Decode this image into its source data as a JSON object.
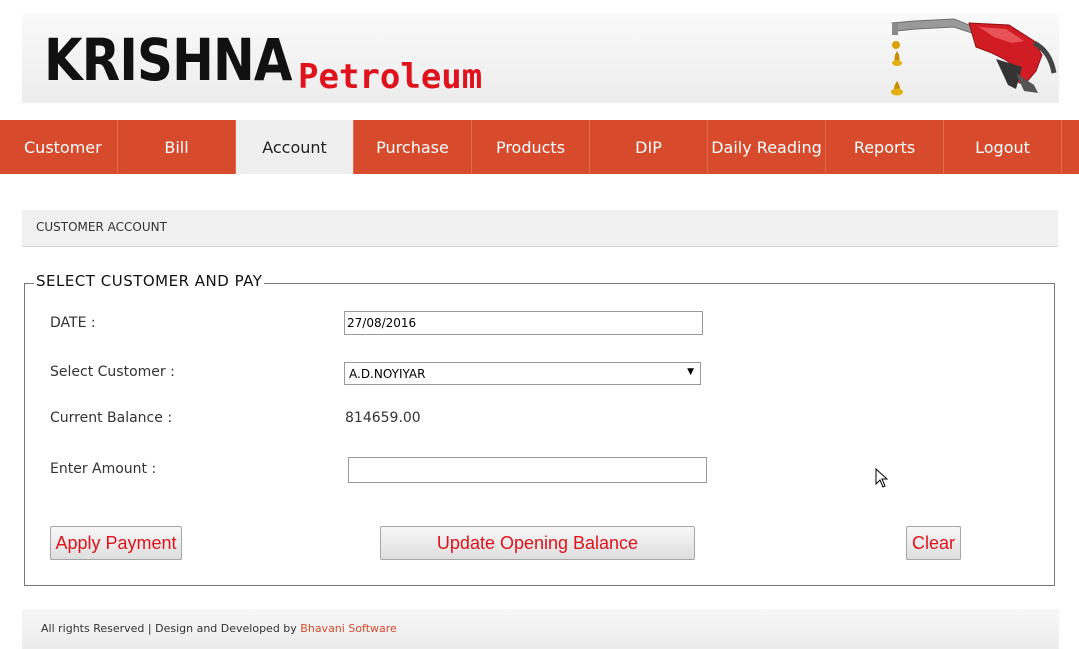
{
  "header": {
    "brand_main": "KRISHNA",
    "brand_sub": "Petroleum",
    "logo_icon": "fuel-nozzle-icon"
  },
  "nav": {
    "items": [
      {
        "label": "Customer"
      },
      {
        "label": "Bill"
      },
      {
        "label": "Account",
        "active": true
      },
      {
        "label": "Purchase"
      },
      {
        "label": "Products"
      },
      {
        "label": "DIP"
      },
      {
        "label": "Daily Reading"
      },
      {
        "label": "Reports"
      },
      {
        "label": "Logout"
      }
    ],
    "color": "#d84a2c"
  },
  "section": {
    "title": "CUSTOMER ACCOUNT"
  },
  "form": {
    "legend": "SELECT  CUSTOMER  AND PAY",
    "date_label": "DATE :",
    "date_value": "27/08/2016",
    "customer_label": "Select Customer :",
    "customer_value": "A.D.NOYIYAR",
    "balance_label": "Current Balance :",
    "balance_value": "814659.00",
    "amount_label": "Enter Amount :",
    "amount_value": ""
  },
  "buttons": {
    "apply": "Apply Payment",
    "update": "Update Opening Balance",
    "clear": "Clear"
  },
  "footer": {
    "text": "All rights Reserved | Design and Developed by ",
    "link": "Bhavani Software"
  },
  "colors": {
    "accent": "#d84a2c",
    "button_text": "#e0121b"
  }
}
